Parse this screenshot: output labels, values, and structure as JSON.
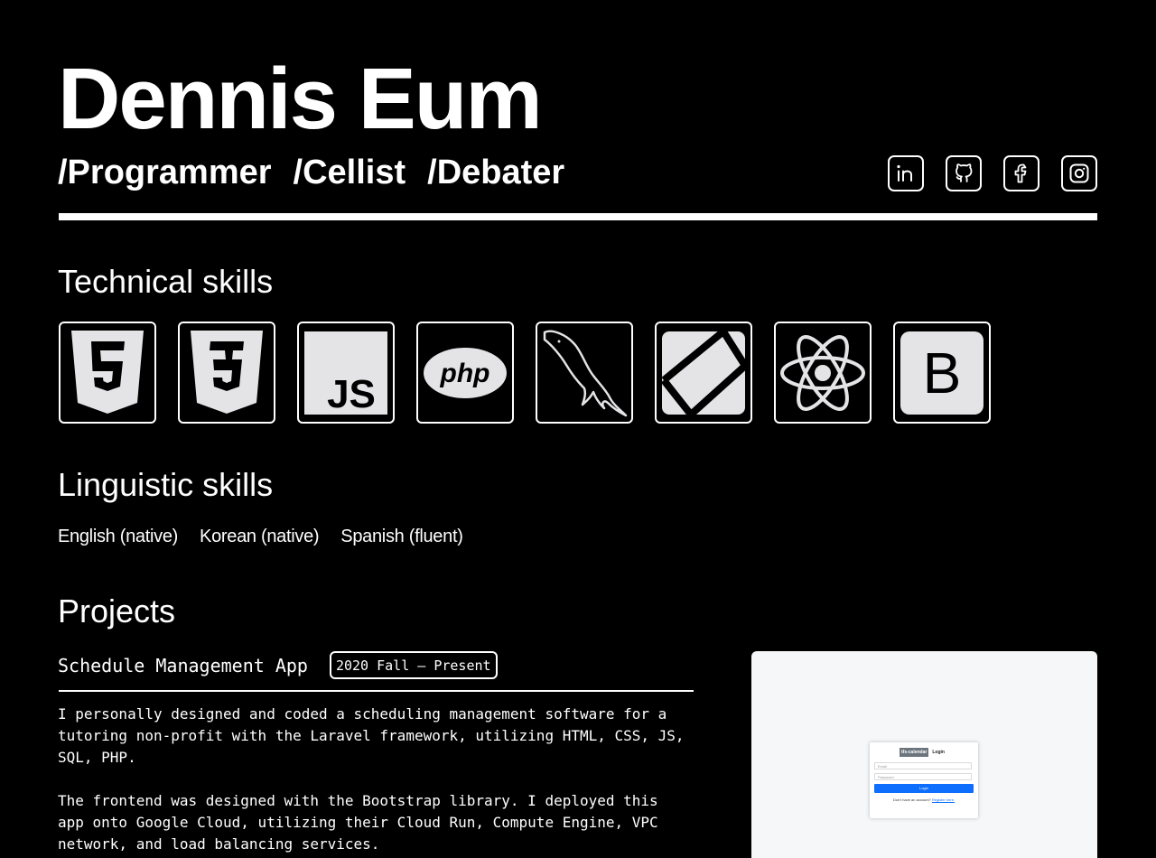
{
  "header": {
    "name": "Dennis Eum",
    "roles": [
      "/Programmer",
      "/Cellist",
      "/Debater"
    ]
  },
  "socials": [
    {
      "icon": "linkedin-icon"
    },
    {
      "icon": "github-icon"
    },
    {
      "icon": "facebook-icon"
    },
    {
      "icon": "instagram-icon"
    }
  ],
  "technical": {
    "title": "Technical skills",
    "icons": [
      "html5-icon",
      "css3-icon",
      "javascript-icon",
      "php-icon",
      "mysql-icon",
      "laravel-icon",
      "react-icon",
      "bootstrap-icon"
    ]
  },
  "linguistic": {
    "title": "Linguistic skills",
    "languages": [
      "English (native)",
      "Korean (native)",
      "Spanish (fluent)"
    ]
  },
  "projects": {
    "title": "Projects",
    "items": [
      {
        "title": "Schedule Management App",
        "date": "2020 Fall – Present",
        "description": [
          "I personally designed and coded a scheduling management software for a\ntutoring non-profit with the Laravel framework, utilizing HTML, CSS, JS,\nSQL, PHP.",
          "The frontend was designed with the Bootstrap library. I deployed this\napp onto Google Cloud, utilizing their Cloud Run, Compute Engine, VPC\nnetwork, and load balancing services."
        ],
        "screenshot": {
          "brand": "tfs-calendar",
          "heading": "Login",
          "email_placeholder": "Email",
          "password_placeholder": "Password",
          "button": "Login",
          "footer_text": "Don't have an account?",
          "footer_link": "Register here."
        }
      }
    ]
  },
  "colors": {
    "background": "#000000",
    "foreground": "#ffffff",
    "icon_fill": "#e4e4e7",
    "button_blue": "#0d6efd"
  }
}
